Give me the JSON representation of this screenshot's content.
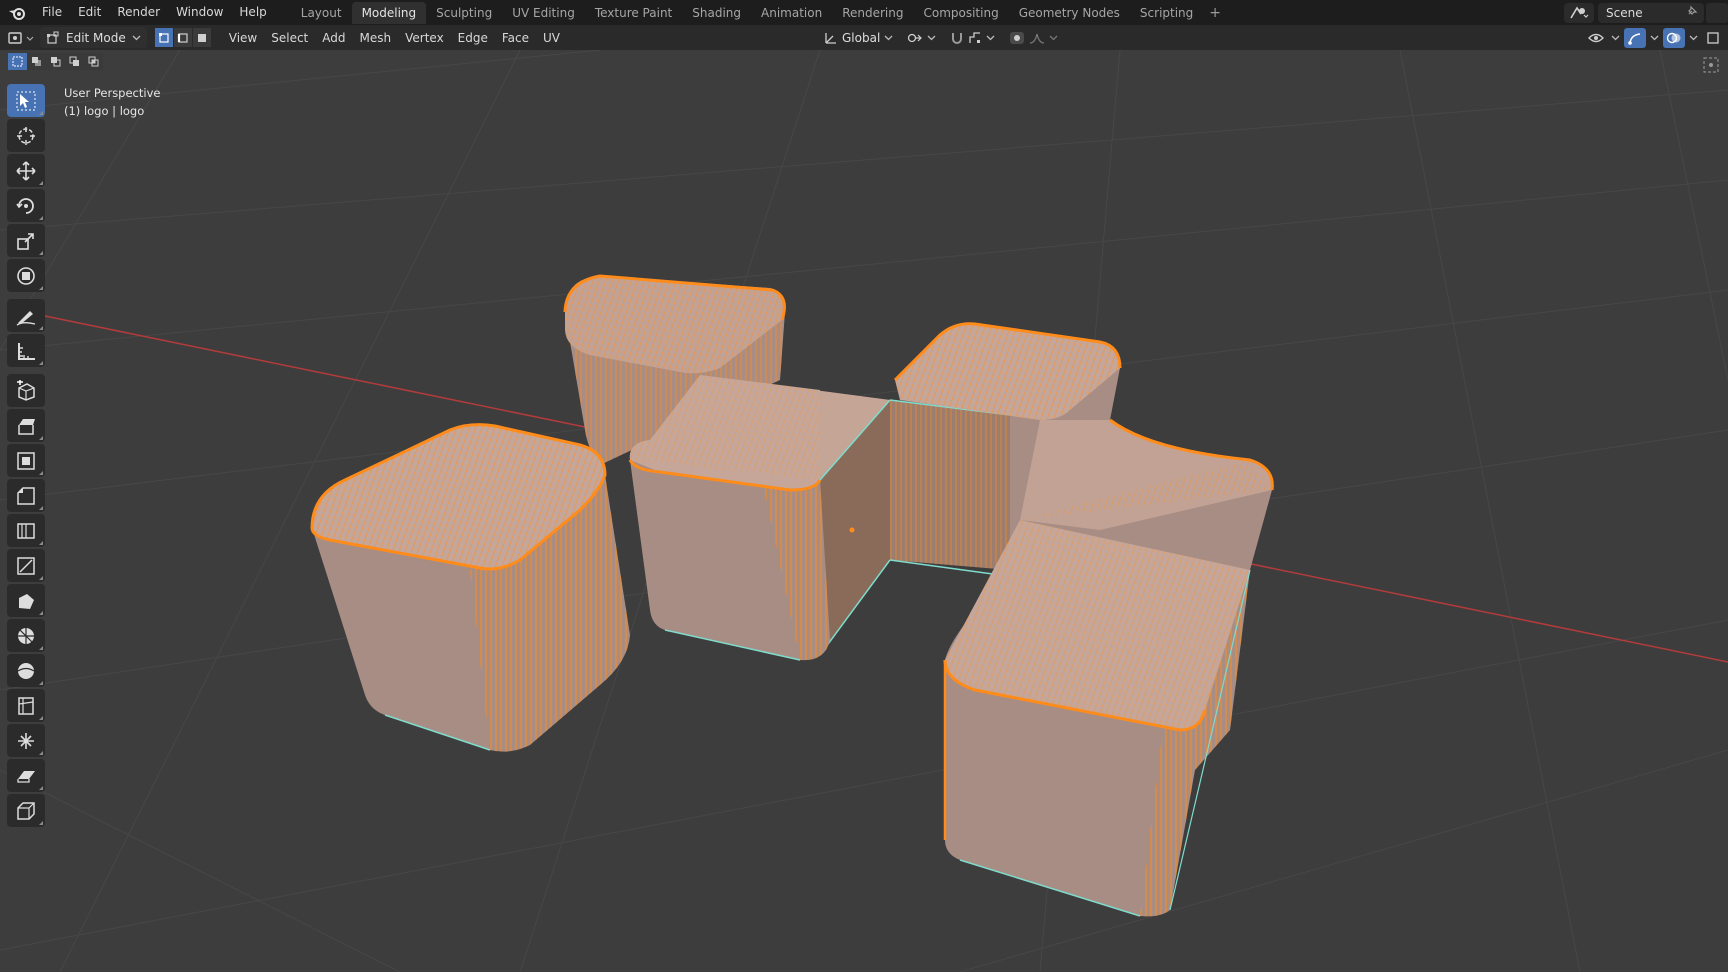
{
  "topbar": {
    "menus": [
      "File",
      "Edit",
      "Render",
      "Window",
      "Help"
    ],
    "workspaces": [
      "Layout",
      "Modeling",
      "Sculpting",
      "UV Editing",
      "Texture Paint",
      "Shading",
      "Animation",
      "Rendering",
      "Compositing",
      "Geometry Nodes",
      "Scripting"
    ],
    "active_workspace": "Modeling",
    "add_label": "+",
    "scene_name": "Scene"
  },
  "header": {
    "mode": "Edit Mode",
    "menus": [
      "View",
      "Select",
      "Add",
      "Mesh",
      "Vertex",
      "Edge",
      "Face",
      "UV"
    ],
    "transform_orientation": "Global"
  },
  "viewport": {
    "view_name": "User Perspective",
    "object_info": "(1) logo | logo"
  },
  "toolbar": {
    "tools": [
      "select-box-icon",
      "cursor-icon",
      "move-icon",
      "rotate-icon",
      "scale-icon",
      "transform-icon",
      "annotate-icon",
      "measure-icon",
      "add-cube-icon",
      "extrude-region-icon",
      "inset-faces-icon",
      "bevel-icon",
      "loop-cut-icon",
      "knife-icon",
      "poly-build-icon",
      "spin-icon",
      "smooth-icon",
      "edge-slide-icon",
      "shrink-fatten-icon",
      "shear-icon",
      "rip-region-icon"
    ],
    "active_tool": "select-box-icon"
  },
  "colors": {
    "selection": "#ff8c1a",
    "face_fill": "#b8978a",
    "active_edge": "#7fdccc",
    "x_axis": "#c23b3b",
    "grid": "#4a4a4a"
  }
}
